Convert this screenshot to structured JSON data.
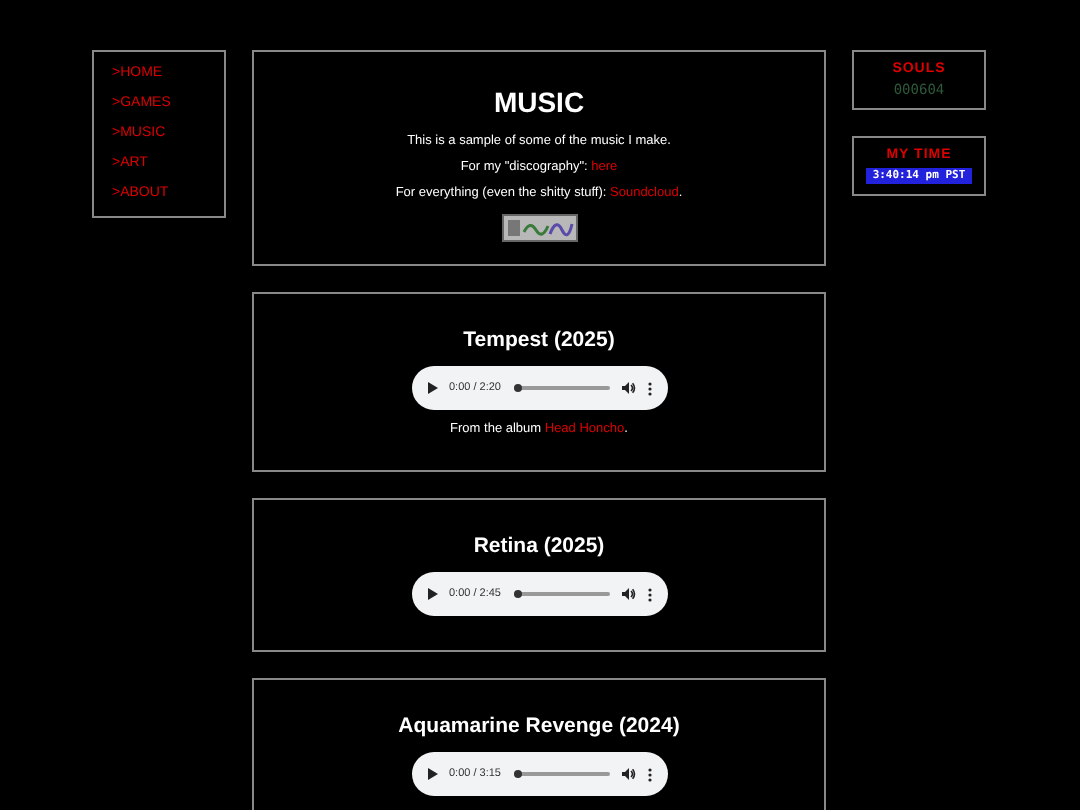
{
  "nav": {
    "items": [
      ">HOME",
      ">GAMES",
      ">MUSIC",
      ">ART",
      ">ABOUT"
    ]
  },
  "intro": {
    "title": "MUSIC",
    "lines": [
      {
        "text": "This is a sample of some of the music I make."
      },
      {
        "text": "For my \"discography\": ",
        "link": "here"
      },
      {
        "text": "For everything (even the shitty stuff): ",
        "link": "Soundcloud",
        "after": "."
      }
    ]
  },
  "tracks": [
    {
      "title": "Tempest (2025)",
      "player": {
        "time": "0:00 / 2:20",
        "level": 0
      },
      "note": {
        "text": "From the album ",
        "link": "Head Honcho",
        "after": "."
      }
    },
    {
      "title": "Retina (2025)",
      "player": {
        "time": "0:00 / 2:45",
        "level": 0
      }
    },
    {
      "title": "Aquamarine Revenge (2024)",
      "player": {
        "time": "0:00 / 3:15",
        "level": 0
      }
    }
  ],
  "widgets": [
    {
      "kind": "counter",
      "title": "SOULS",
      "value": "000604"
    },
    {
      "kind": "clock",
      "title": "MY TIME",
      "value": "3:40:14 pm PST"
    }
  ]
}
